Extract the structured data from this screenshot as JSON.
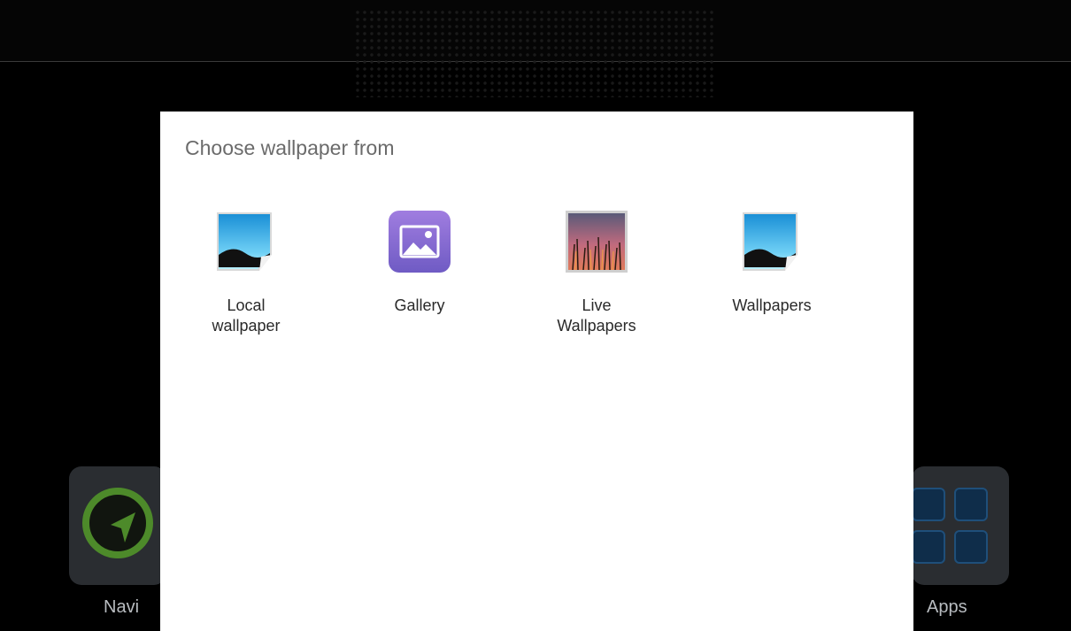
{
  "dialog": {
    "title": "Choose wallpaper from",
    "options": [
      {
        "label": "Local\nwallpaper",
        "icon": "landscape-image-icon"
      },
      {
        "label": "Gallery",
        "icon": "gallery-icon"
      },
      {
        "label": "Live\nWallpapers",
        "icon": "live-wallpaper-icon"
      },
      {
        "label": "Wallpapers",
        "icon": "landscape-image-icon"
      }
    ]
  },
  "dock": {
    "navi_label": "Navi",
    "apps_label": "Apps"
  },
  "colors": {
    "navi_green": "#4d8a2a",
    "gallery_purple": "#8a6fd0",
    "dialog_bg": "#ffffff"
  }
}
